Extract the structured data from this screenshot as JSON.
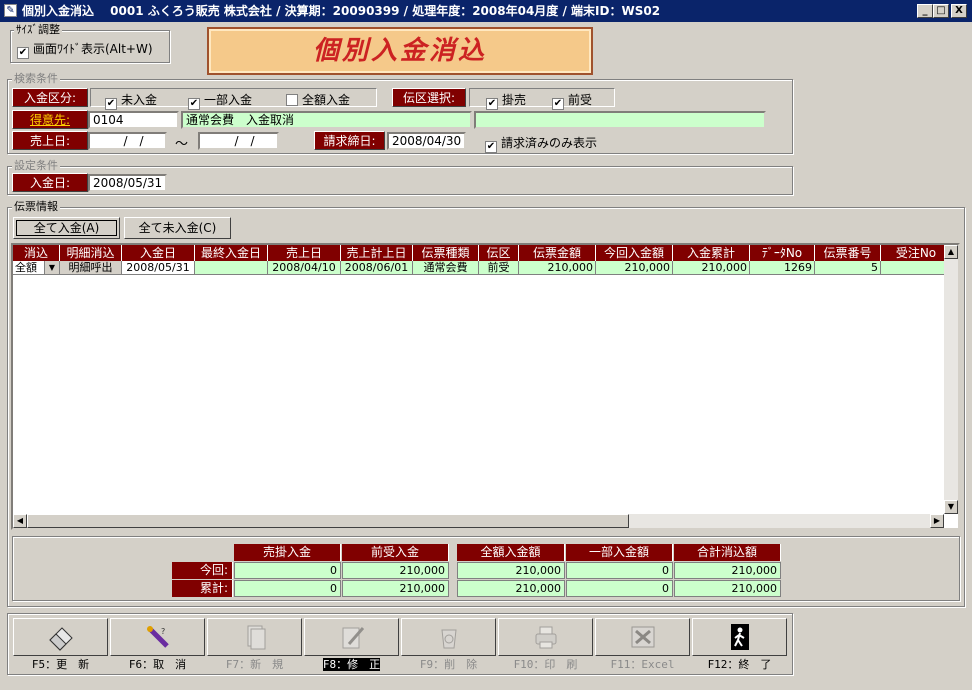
{
  "window": {
    "title": "個別入金消込　 0001 ふくろう販売 株式会社 / 決算期：20090399 / 処理年度：2008年04月度 / 端末ID：WS02",
    "buttons": [
      "_",
      "□",
      "X"
    ]
  },
  "size_group": {
    "label": "ｻｲｽﾞ調整",
    "wide_checkbox": "画面ﾜｲﾄﾞ表示(Alt+W)",
    "checked": true
  },
  "banner": "個別入金消込",
  "search": {
    "label": "検索条件",
    "nyukin_kubun_label": "入金区分:",
    "nyukin_options": [
      {
        "label": "未入金",
        "checked": true
      },
      {
        "label": "一部入金",
        "checked": true
      },
      {
        "label": "全額入金",
        "checked": false
      }
    ],
    "denku_label": "伝区選択:",
    "denku_options": [
      {
        "label": "掛売",
        "checked": true
      },
      {
        "label": "前受",
        "checked": true
      }
    ],
    "tokuisaki_label": "得意先:",
    "tokuisaki_code": "0104",
    "tokuisaki_name": "通常会費　入金取消",
    "tokuisaki_extra": "",
    "uriagebi_label": "売上日:",
    "date_from": "　/　/",
    "tilde": "～",
    "date_to": "　/　/",
    "seikyu_label": "請求締日:",
    "seikyu_date": "2008/04/30",
    "seikyu_only_label": "請求済みのみ表示",
    "seikyu_only_checked": true
  },
  "settings": {
    "label": "設定条件",
    "nyukinbi_label": "入金日:",
    "nyukinbi": "2008/05/31"
  },
  "slip": {
    "label": "伝票情報",
    "btn_all_paid": "全て入金(A)",
    "btn_all_unpaid": "全て未入金(C)",
    "headers": [
      "消込",
      "明細消込",
      "入金日",
      "最終入金日",
      "売上日",
      "売上計上日",
      "伝票種類",
      "伝区",
      "伝票金額",
      "今回入金額",
      "入金累計",
      "ﾃﾞｰﾀNo",
      "伝票番号",
      "受注No"
    ],
    "rows": [
      {
        "kesikomi": "全額",
        "detail": "明細呼出",
        "nyukinbi": "2008/05/31",
        "last": "",
        "uriage": "2008/04/10",
        "keijo": "2008/06/01",
        "shurui": "通常会費",
        "denku": "前受",
        "kingaku": "210,000",
        "konkai": "210,000",
        "ruikei": "210,000",
        "data_no": "1269",
        "denpyo_no": "5",
        "juchu_no": ""
      }
    ]
  },
  "summary": {
    "headers_left": [
      "売掛入金",
      "前受入金"
    ],
    "headers_right": [
      "全額入金額",
      "一部入金額",
      "合計消込額"
    ],
    "rows": [
      {
        "label": "今回:",
        "urikake": "0",
        "maeuke": "210,000",
        "zengaku": "210,000",
        "ichibu": "0",
        "gokei": "210,000"
      },
      {
        "label": "累計:",
        "urikake": "0",
        "maeuke": "210,000",
        "zengaku": "210,000",
        "ichibu": "0",
        "gokei": "210,000"
      }
    ]
  },
  "fkeys": [
    {
      "label": "F5：更　新",
      "icon": "eraser-icon",
      "enabled": true
    },
    {
      "label": "F6：取　消",
      "icon": "cancel-icon",
      "enabled": true
    },
    {
      "label": "F7：新　規",
      "icon": "new-document-icon",
      "enabled": false
    },
    {
      "label": "F8：修　正",
      "icon": "edit-icon",
      "enabled": false,
      "selected": true
    },
    {
      "label": "F9：削　除",
      "icon": "recycle-icon",
      "enabled": false
    },
    {
      "label": "F10：印　刷",
      "icon": "printer-icon",
      "enabled": false
    },
    {
      "label": "F11：Excel",
      "icon": "excel-icon",
      "enabled": false
    },
    {
      "label": "F12：終　了",
      "icon": "exit-icon",
      "enabled": true
    }
  ]
}
